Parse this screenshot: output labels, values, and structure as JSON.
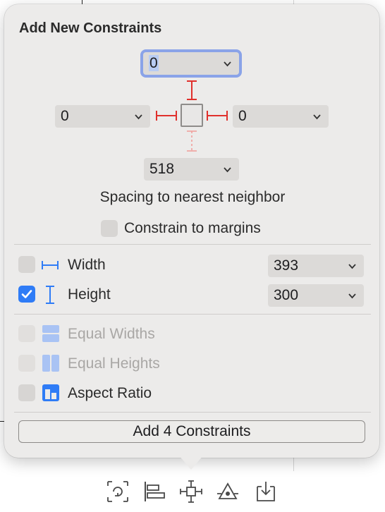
{
  "popover": {
    "title": "Add New Constraints",
    "spacing": {
      "top": "0",
      "left": "0",
      "right": "0",
      "bottom": "518"
    },
    "caption": "Spacing to nearest neighbor",
    "constrain_to_margins": {
      "label": "Constrain to margins",
      "checked": false
    },
    "width": {
      "label": "Width",
      "value": "393",
      "checked": false
    },
    "height": {
      "label": "Height",
      "value": "300",
      "checked": true
    },
    "equal_widths": {
      "label": "Equal Widths",
      "checked": false,
      "enabled": false
    },
    "equal_heights": {
      "label": "Equal Heights",
      "checked": false,
      "enabled": false
    },
    "aspect_ratio": {
      "label": "Aspect Ratio",
      "checked": false
    },
    "add_button_label": "Add 4 Constraints"
  },
  "toolbar": {
    "icons": [
      "update-frames-icon",
      "align-icon",
      "add-constraints-icon",
      "resolve-issues-icon",
      "embed-in-icon"
    ]
  },
  "colors": {
    "accent": "#2f7cf6",
    "constraint_red": "#e0302c",
    "focus_ring": "#8aa3e8"
  }
}
